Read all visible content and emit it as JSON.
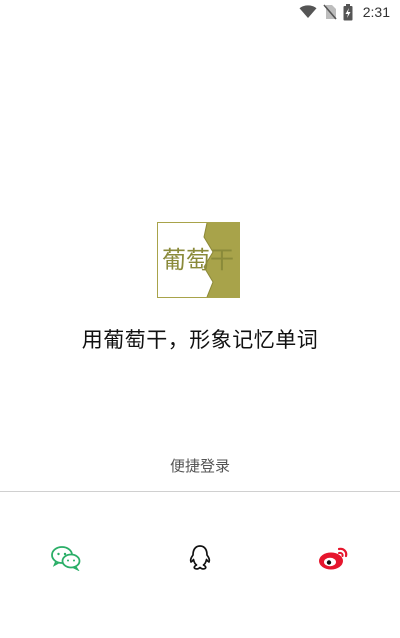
{
  "status_bar": {
    "time": "2:31",
    "icons": [
      "wifi-icon",
      "no-sim-icon",
      "battery-charging-icon"
    ]
  },
  "logo": {
    "text": "葡萄干",
    "colors": {
      "olive": "#a8a34a",
      "border": "#a8a34a"
    }
  },
  "slogan": "用葡萄干，形象记忆单词",
  "quick_login": {
    "label": "便捷登录",
    "options": [
      {
        "name": "wechat",
        "icon": "wechat-icon",
        "color": "#2aae67"
      },
      {
        "name": "qq",
        "icon": "qq-icon",
        "color": "#111111"
      },
      {
        "name": "weibo",
        "icon": "weibo-icon",
        "color": "#e6162d"
      }
    ]
  }
}
